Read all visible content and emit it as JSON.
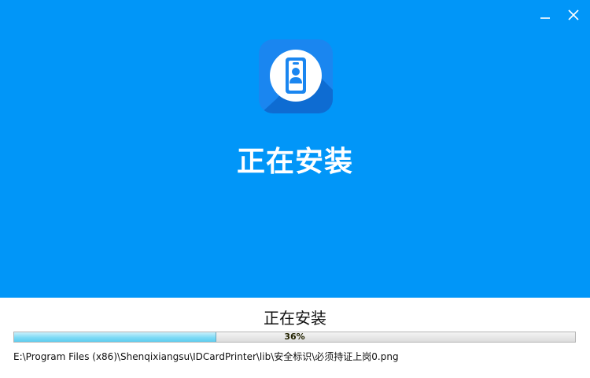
{
  "window": {
    "minimize_icon": "minimize-icon",
    "close_icon": "close-icon"
  },
  "hero": {
    "app_icon": "id-badge-icon",
    "title": "正在安装"
  },
  "status": {
    "label": "正在安装",
    "progress_text": "36%",
    "progress_value": 0.36,
    "current_file": "E:\\Program Files (x86)\\Shenqixiangsu\\IDCardPrinter\\lib\\安全标识\\必须持证上岗0.png"
  },
  "colors": {
    "hero_background": "#0196f8",
    "progress_fill": "#7fdaf5",
    "icon_tile": "#1a86f0"
  }
}
